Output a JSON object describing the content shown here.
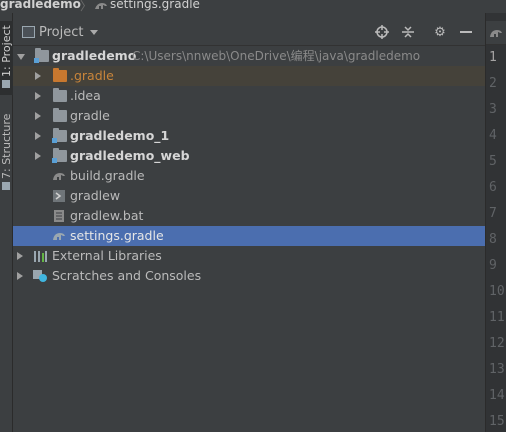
{
  "breadcrumb": {
    "project": "gradledemo",
    "file": "settings.gradle"
  },
  "toolstrip": {
    "project_tab": "1: Project",
    "structure_tab": "7: Structure"
  },
  "panel": {
    "title": "Project",
    "root": {
      "name": "gradledemo",
      "path": "C:\\Users\\nnweb\\OneDrive\\编程\\java\\gradledemo"
    },
    "items": [
      {
        "label": ".gradle"
      },
      {
        "label": ".idea"
      },
      {
        "label": "gradle"
      },
      {
        "label": "gradledemo_1"
      },
      {
        "label": "gradledemo_web"
      },
      {
        "label": "build.gradle"
      },
      {
        "label": "gradlew"
      },
      {
        "label": "gradlew.bat"
      },
      {
        "label": "settings.gradle"
      }
    ],
    "external_libraries": "External Libraries",
    "scratches": "Scratches and Consoles"
  },
  "colors": {
    "selection": "#4b6eaf",
    "highlight": "#45423a",
    "orange_folder": "#c8782f"
  },
  "gutter": {
    "lines": [
      "1",
      "2",
      "3",
      "4",
      "5",
      "6",
      "7",
      "8",
      "9",
      "10",
      "11",
      "12",
      "13",
      "14",
      "15"
    ]
  }
}
